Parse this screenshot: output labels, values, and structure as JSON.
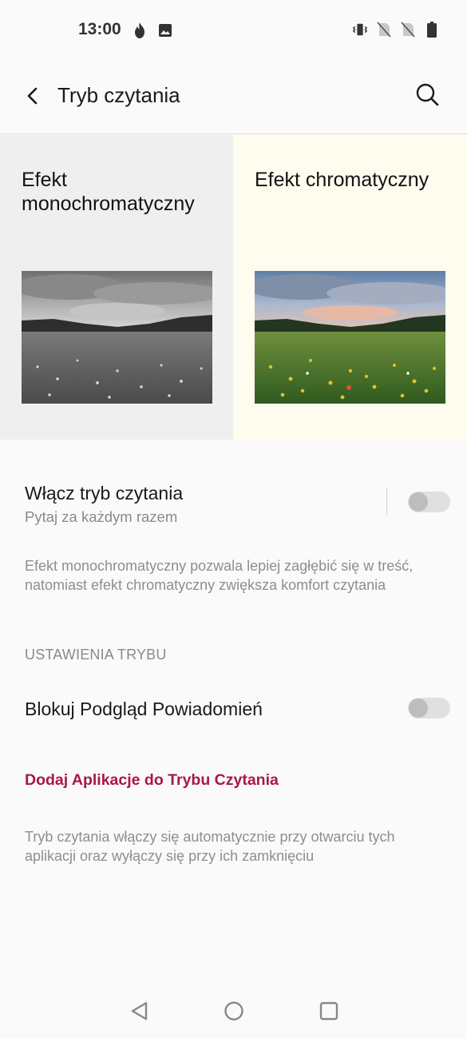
{
  "status_bar": {
    "time": "13:00",
    "left_icons": [
      "flame-icon",
      "image-icon"
    ],
    "right_icons": [
      "vibrate-icon",
      "no-sim-icon",
      "no-sim-icon",
      "battery-icon"
    ]
  },
  "app_bar": {
    "title": "Tryb czytania",
    "back_icon": "back-arrow-icon",
    "search_icon": "search-icon"
  },
  "previews": {
    "mono": {
      "title": "Efekt monochromatyczny",
      "background": "#efefef"
    },
    "chroma": {
      "title": "Efekt chromatyczny",
      "background": "#fdfcee"
    }
  },
  "reading_mode": {
    "title": "Włącz tryb czytania",
    "subtitle": "Pytaj za każdym razem",
    "enabled": false
  },
  "description": "Efekt monochromatyczny pozwala lepiej zagłębić się w treść, natomiast efekt chromatyczny zwiększa komfort czytania",
  "section_header": "USTAWIENIA TRYBU",
  "block_notifications": {
    "title": "Blokuj Podgląd Powiadomień",
    "enabled": false
  },
  "add_apps_link": "Dodaj Aplikacje do Trybu Czytania",
  "footer_note": "Tryb czytania włączy się automatycznie przy otwarciu tych aplikacji oraz wyłączy się przy ich zamknięciu",
  "colors": {
    "accent": "#a8174f",
    "toggle_off": "#e0e0e0"
  },
  "nav_bar": [
    "back-triangle-icon",
    "home-circle-icon",
    "recents-square-icon"
  ]
}
